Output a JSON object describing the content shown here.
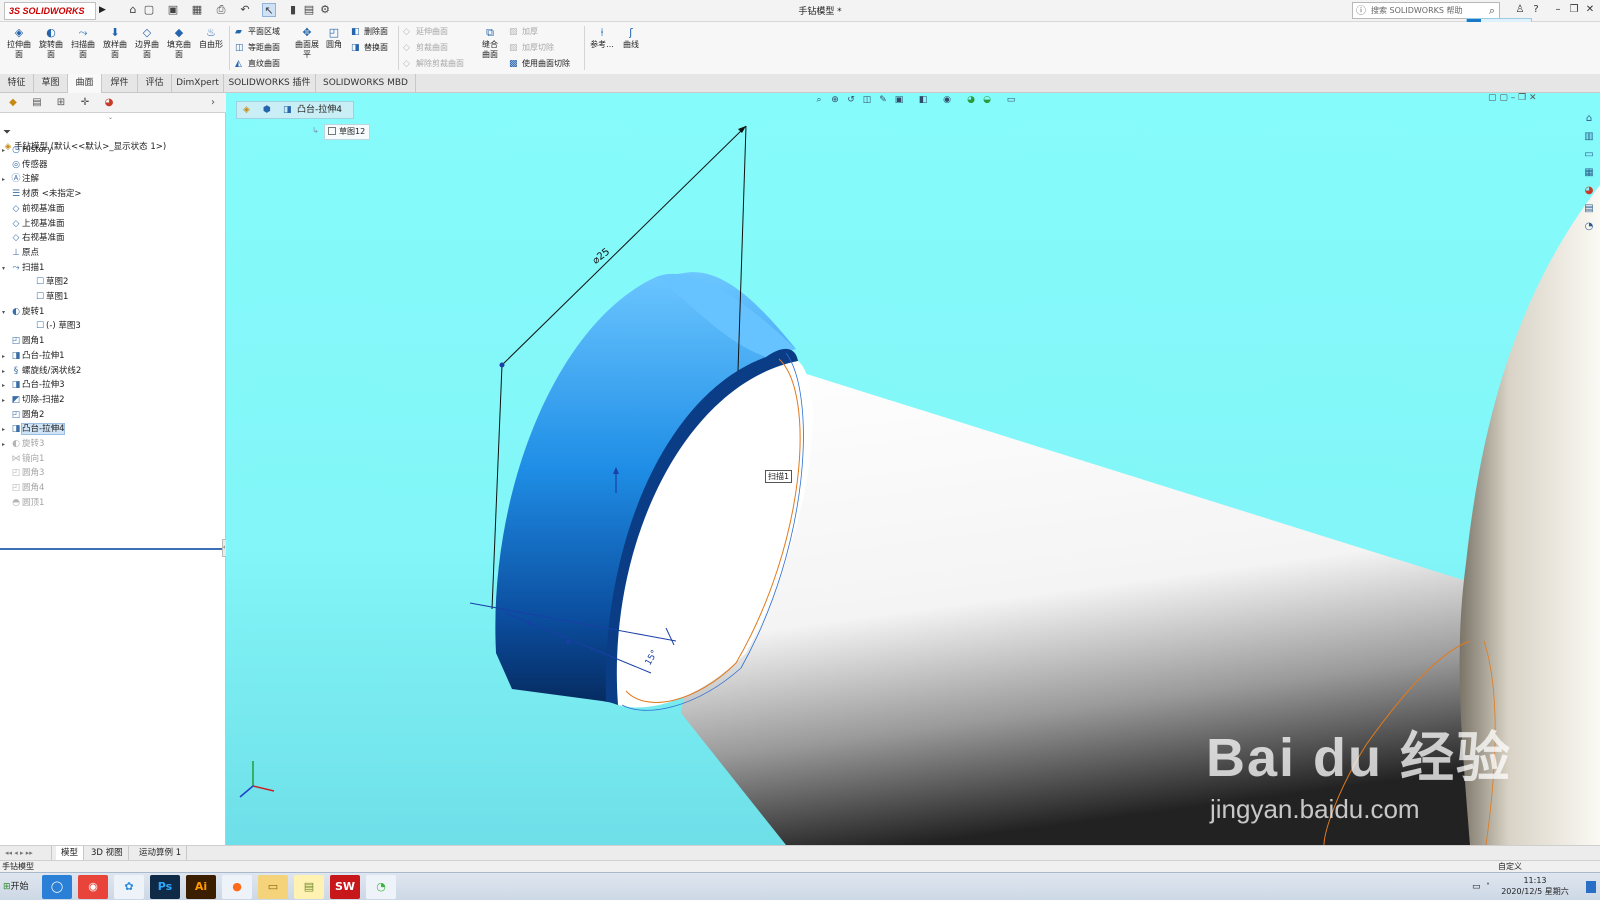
{
  "app": {
    "logo": "3S SOLIDWORKS",
    "document_title": "手钻模型 *",
    "search_placeholder": "搜索 SOLIDWORKS 帮助"
  },
  "ribbon": {
    "big_buttons": [
      {
        "label": "拉伸曲\n面",
        "icon": "extrude-surface-icon"
      },
      {
        "label": "旋转曲\n面",
        "icon": "revolve-surface-icon"
      },
      {
        "label": "扫描曲\n面",
        "icon": "sweep-surface-icon"
      },
      {
        "label": "放样曲\n面",
        "icon": "loft-surface-icon"
      },
      {
        "label": "边界曲\n面",
        "icon": "boundary-surface-icon"
      },
      {
        "label": "填充曲\n面",
        "icon": "fill-surface-icon"
      },
      {
        "label": "自由形",
        "icon": "freeform-icon"
      }
    ],
    "group2": [
      "平面区域",
      "等距曲面",
      "直纹曲面"
    ],
    "flatten": "曲面展\n平",
    "fillet": "圆角",
    "group3": [
      "删除面",
      "替换面"
    ],
    "group4_disabled": [
      "延伸曲面",
      "剪裁曲面",
      "解除剪裁曲面"
    ],
    "knit": "缝合\n曲面",
    "group5": [
      {
        "label": "加厚",
        "disabled": true
      },
      {
        "label": "加厚切除",
        "disabled": true
      },
      {
        "label": "使用曲面切除",
        "disabled": false
      }
    ],
    "reference": "参考...",
    "curves": "曲线"
  },
  "tabs": [
    {
      "label": "特征",
      "active": false
    },
    {
      "label": "草图",
      "active": false
    },
    {
      "label": "曲面",
      "active": true
    },
    {
      "label": "焊件",
      "active": false
    },
    {
      "label": "评估",
      "active": false
    },
    {
      "label": "DimXpert",
      "active": false
    },
    {
      "label": "SOLIDWORKS 插件",
      "active": false
    },
    {
      "label": "SOLIDWORKS MBD",
      "active": false
    }
  ],
  "feature_tree": {
    "root": "手钻模型  (默认<<默认>_显示状态 1>)",
    "items": [
      {
        "label": "History",
        "level": 1,
        "expander": "▸",
        "icon": "history-icon",
        "state": "normal"
      },
      {
        "label": "传感器",
        "level": 1,
        "expander": "",
        "icon": "sensor-icon",
        "state": "normal"
      },
      {
        "label": "注解",
        "level": 1,
        "expander": "▸",
        "icon": "annotation-icon",
        "state": "normal"
      },
      {
        "label": "材质 <未指定>",
        "level": 1,
        "expander": "",
        "icon": "material-icon",
        "state": "normal"
      },
      {
        "label": "前视基准面",
        "level": 1,
        "expander": "",
        "icon": "plane-icon",
        "state": "normal"
      },
      {
        "label": "上视基准面",
        "level": 1,
        "expander": "",
        "icon": "plane-icon",
        "state": "normal"
      },
      {
        "label": "右视基准面",
        "level": 1,
        "expander": "",
        "icon": "plane-icon",
        "state": "normal"
      },
      {
        "label": "原点",
        "level": 1,
        "expander": "",
        "icon": "origin-icon",
        "state": "normal"
      },
      {
        "label": "扫描1",
        "level": 1,
        "expander": "▾",
        "icon": "sweep-icon",
        "state": "normal"
      },
      {
        "label": "草图2",
        "level": 2,
        "expander": "",
        "icon": "sketch-icon",
        "state": "normal"
      },
      {
        "label": "草图1",
        "level": 2,
        "expander": "",
        "icon": "sketch-icon",
        "state": "normal"
      },
      {
        "label": "旋转1",
        "level": 1,
        "expander": "▾",
        "icon": "revolve-icon",
        "state": "normal"
      },
      {
        "label": "(-) 草图3",
        "level": 2,
        "expander": "",
        "icon": "sketch-icon",
        "state": "normal"
      },
      {
        "label": "圆角1",
        "level": 1,
        "expander": "",
        "icon": "fillet-icon",
        "state": "normal"
      },
      {
        "label": "凸台-拉伸1",
        "level": 1,
        "expander": "▸",
        "icon": "boss-extrude-icon",
        "state": "normal"
      },
      {
        "label": "螺旋线/涡状线2",
        "level": 1,
        "expander": "▸",
        "icon": "helix-icon",
        "state": "normal"
      },
      {
        "label": "凸台-拉伸3",
        "level": 1,
        "expander": "▸",
        "icon": "boss-extrude-icon",
        "state": "normal"
      },
      {
        "label": "切除-扫描2",
        "level": 1,
        "expander": "▸",
        "icon": "cut-sweep-icon",
        "state": "normal"
      },
      {
        "label": "圆角2",
        "level": 1,
        "expander": "",
        "icon": "fillet-icon",
        "state": "normal"
      },
      {
        "label": "凸台-拉伸4",
        "level": 1,
        "expander": "▸",
        "icon": "boss-extrude-icon",
        "state": "selected"
      },
      {
        "label": "旋转3",
        "level": 1,
        "expander": "▸",
        "icon": "revolve-icon",
        "state": "suppressed"
      },
      {
        "label": "镜向1",
        "level": 1,
        "expander": "",
        "icon": "mirror-icon",
        "state": "suppressed"
      },
      {
        "label": "圆角3",
        "level": 1,
        "expander": "",
        "icon": "fillet-icon",
        "state": "suppressed"
      },
      {
        "label": "圆角4",
        "level": 1,
        "expander": "",
        "icon": "fillet-icon",
        "state": "suppressed"
      },
      {
        "label": "圆顶1",
        "level": 1,
        "expander": "",
        "icon": "dome-icon",
        "state": "suppressed"
      }
    ]
  },
  "viewport": {
    "breadcrumb": "凸台-拉伸4",
    "breadcrumb_child": "草图12",
    "dim_diameter": "⌀25",
    "dim_angle": "15°",
    "sweep_tag": "扫描1",
    "watermark_line1": "Bai du 经验",
    "watermark_line2": "jingyan.baidu.com",
    "colors": {
      "background": "#82f6f8",
      "ring_light": "#49b6f6",
      "ring_dark": "#0a3d86",
      "sketch_line": "#1a1a1a",
      "edge_curve": "#e07a1c"
    }
  },
  "bottom_tabs": [
    {
      "label": "模型",
      "active": true
    },
    {
      "label": "3D 视图",
      "active": false
    },
    {
      "label": "运动算例 1",
      "active": false
    }
  ],
  "status": {
    "left": "手钻模型",
    "right": "自定义"
  },
  "taskbar": {
    "start": "开始",
    "apps": [
      {
        "name": "browser-360-icon",
        "glyph": "◯",
        "bg": "#2a7fd6",
        "fg": "#fff"
      },
      {
        "name": "chrome-icon",
        "glyph": "◉",
        "bg": "#e8443a",
        "fg": "#fff"
      },
      {
        "name": "baidu-netdisk-icon",
        "glyph": "✿",
        "bg": "#eef3fa",
        "fg": "#2b8ae0"
      },
      {
        "name": "photoshop-icon",
        "glyph": "Ps",
        "bg": "#0e2a47",
        "fg": "#31a8ff"
      },
      {
        "name": "illustrator-icon",
        "glyph": "Ai",
        "bg": "#3b1d00",
        "fg": "#ff9a00"
      },
      {
        "name": "firefox-icon",
        "glyph": "●",
        "bg": "#eef3fa",
        "fg": "#ff6a1a"
      },
      {
        "name": "file-explorer-icon",
        "glyph": "▭",
        "bg": "#f5d37a",
        "fg": "#8a6410"
      },
      {
        "name": "notepad-icon",
        "glyph": "▤",
        "bg": "#fff2b3",
        "fg": "#6e8a2a"
      },
      {
        "name": "solidworks-taskbar-icon",
        "glyph": "SW",
        "bg": "#c8171b",
        "fg": "#fff"
      },
      {
        "name": "wechat-icon",
        "glyph": "◔",
        "bg": "#eef3fa",
        "fg": "#3bb53b"
      }
    ],
    "time": "11:13",
    "date": "2020/12/5 星期六"
  }
}
